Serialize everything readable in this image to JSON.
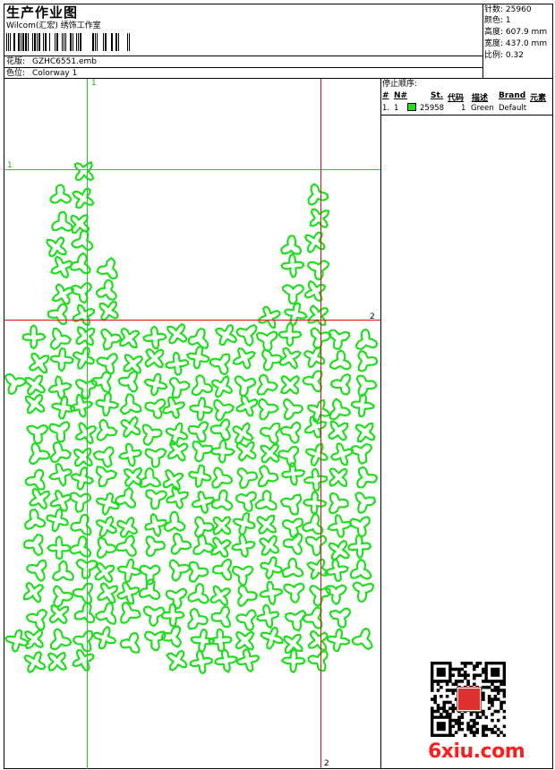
{
  "header": {
    "title": "生产作业图",
    "company": "Wilcom(汇宏) 绣饰工作室",
    "design_label": "花版:",
    "design_value": "GZHC6551.emb",
    "colorway_label": "色位:",
    "colorway_value": "Colorway 1"
  },
  "stats": {
    "stitches_label": "针数:",
    "stitches_value": "25960",
    "colors_label": "颜色:",
    "colors_value": "1",
    "height_label": "高度:",
    "height_value": "607.9 mm",
    "width_label": "宽度:",
    "width_value": "437.0 mm",
    "scale_label": "比例:",
    "scale_value": "0.32"
  },
  "stop_sequence": {
    "title": "停止顺序:",
    "columns": [
      "#",
      "N#",
      "St.",
      "代码",
      "描述",
      "Brand",
      "元素"
    ],
    "rows": [
      {
        "num": "1.",
        "n": "1",
        "stitches": "25958",
        "code": "1",
        "desc": "Green",
        "brand": "Default"
      }
    ]
  },
  "guides": {
    "v_green": "1",
    "h_green": "1",
    "h_red": "2",
    "v_red": "2"
  },
  "colors": {
    "thread": "#22dd22",
    "guide_green": "#22cc22",
    "guide_red": "#e01010",
    "brand_red": "#ff1e1e"
  },
  "watermark": {
    "site": "6xiu.com"
  }
}
